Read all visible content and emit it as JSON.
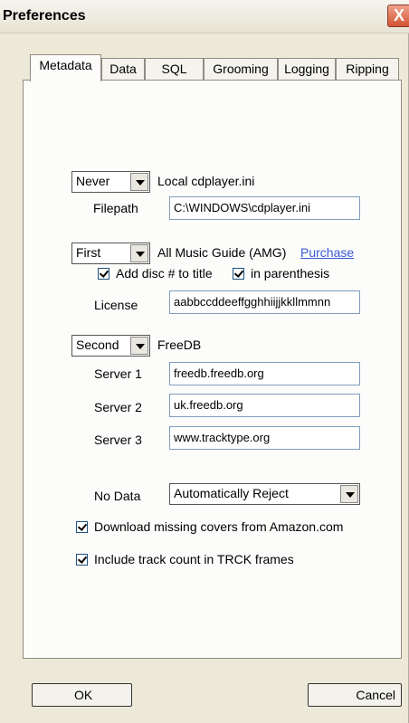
{
  "window": {
    "title": "Preferences",
    "close_label": "X"
  },
  "tabs": [
    {
      "label": "Metadata",
      "active": true
    },
    {
      "label": "Data"
    },
    {
      "label": "SQL"
    },
    {
      "label": "Grooming"
    },
    {
      "label": "Logging"
    },
    {
      "label": "Ripping"
    }
  ],
  "local": {
    "priority": "Never",
    "source_label": "Local cdplayer.ini",
    "filepath_label": "Filepath",
    "filepath_value": "C:\\WINDOWS\\cdplayer.ini"
  },
  "amg": {
    "priority": "First",
    "source_label": "All Music Guide (AMG)",
    "purchase_link": "Purchase",
    "add_disc_label": "Add disc # to title",
    "add_disc_checked": true,
    "parenthesis_label": "in parenthesis",
    "parenthesis_checked": true,
    "license_label": "License",
    "license_value": "aabbccddeeffgghhiijjkkllmmnn"
  },
  "freedb": {
    "priority": "Second",
    "source_label": "FreeDB",
    "server1_label": "Server 1",
    "server1_value": "freedb.freedb.org",
    "server2_label": "Server 2",
    "server2_value": "uk.freedb.org",
    "server3_label": "Server 3",
    "server3_value": "www.tracktype.org"
  },
  "nodata": {
    "label": "No Data",
    "value": "Automatically Reject"
  },
  "options": {
    "download_covers_label": "Download missing covers from Amazon.com",
    "download_covers_checked": true,
    "track_count_label": "Include track count in TRCK frames",
    "track_count_checked": true
  },
  "buttons": {
    "ok": "OK",
    "cancel": "Cancel"
  }
}
